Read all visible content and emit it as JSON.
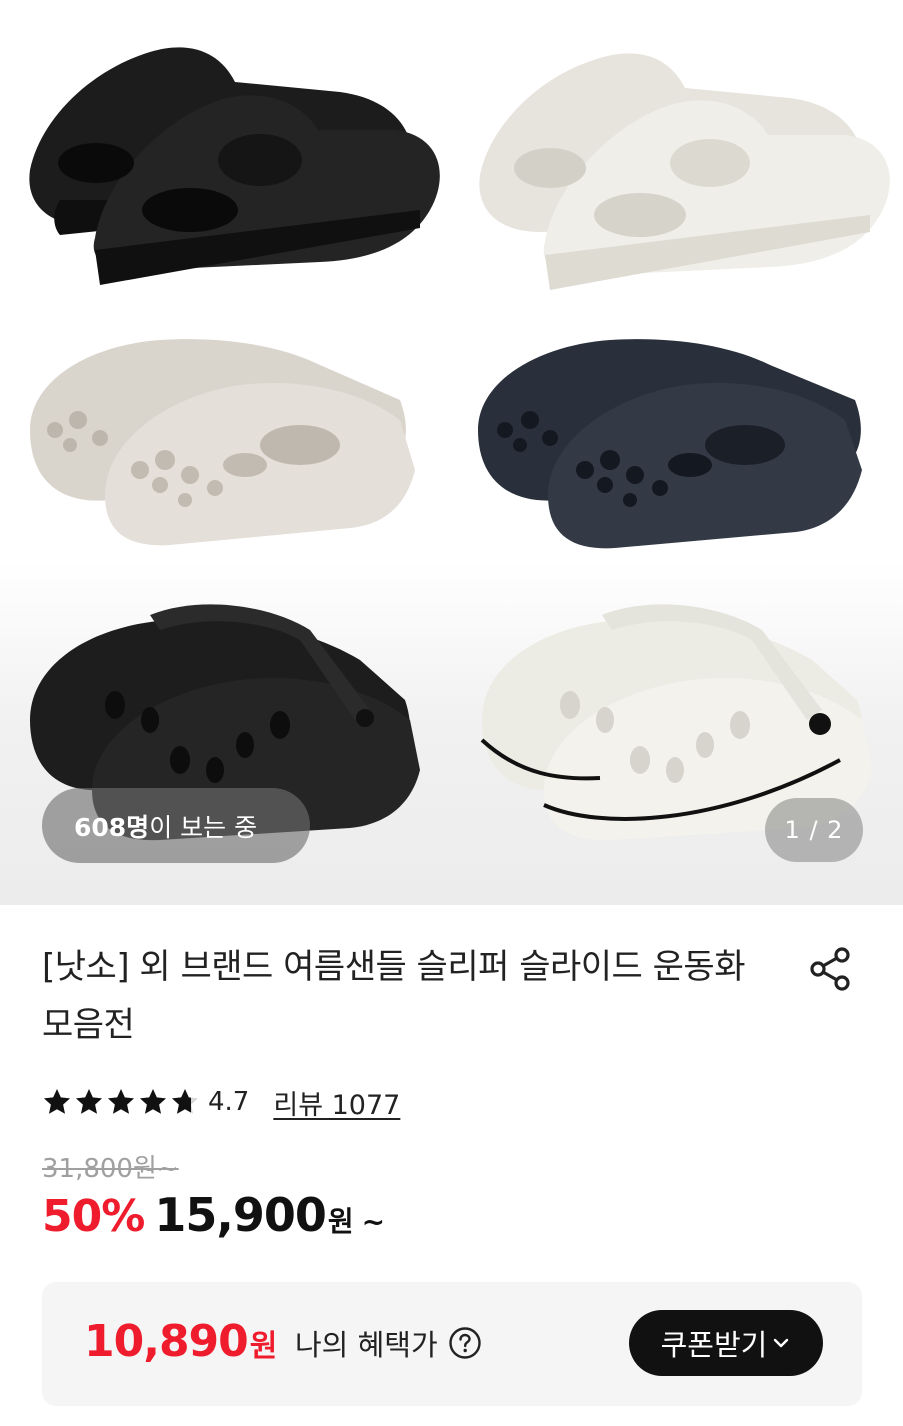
{
  "hero": {
    "viewers_count": "608명",
    "viewers_suffix": "이 보는 중",
    "page_indicator": "1 / 2",
    "images": [
      {
        "name": "black-slide-sandal",
        "color": "#1e1e1e"
      },
      {
        "name": "white-slide-sandal",
        "color": "#ecebe5"
      },
      {
        "name": "beige-clog",
        "color": "#ddd8d1"
      },
      {
        "name": "navy-clog",
        "color": "#2e3440"
      },
      {
        "name": "black-strap-clog",
        "color": "#1f1f1f"
      },
      {
        "name": "white-strap-clog",
        "color": "#f0efe9"
      }
    ]
  },
  "product": {
    "title": "[낫소] 외 브랜드 여름샌들 슬리퍼 슬라이드 운동화 모음전",
    "rating": "4.7",
    "stars": 4.7,
    "review_label": "리뷰 1077",
    "original_price": "31,800원~",
    "discount": "50%",
    "sale_price": "15,900",
    "sale_unit": "원",
    "sale_suffix": "~"
  },
  "benefit": {
    "price": "10,890",
    "unit": "원",
    "label": "나의 혜택가",
    "coupon_button": "쿠폰받기"
  },
  "colors": {
    "accent_red": "#ee1c2c",
    "button_black": "#111111"
  }
}
